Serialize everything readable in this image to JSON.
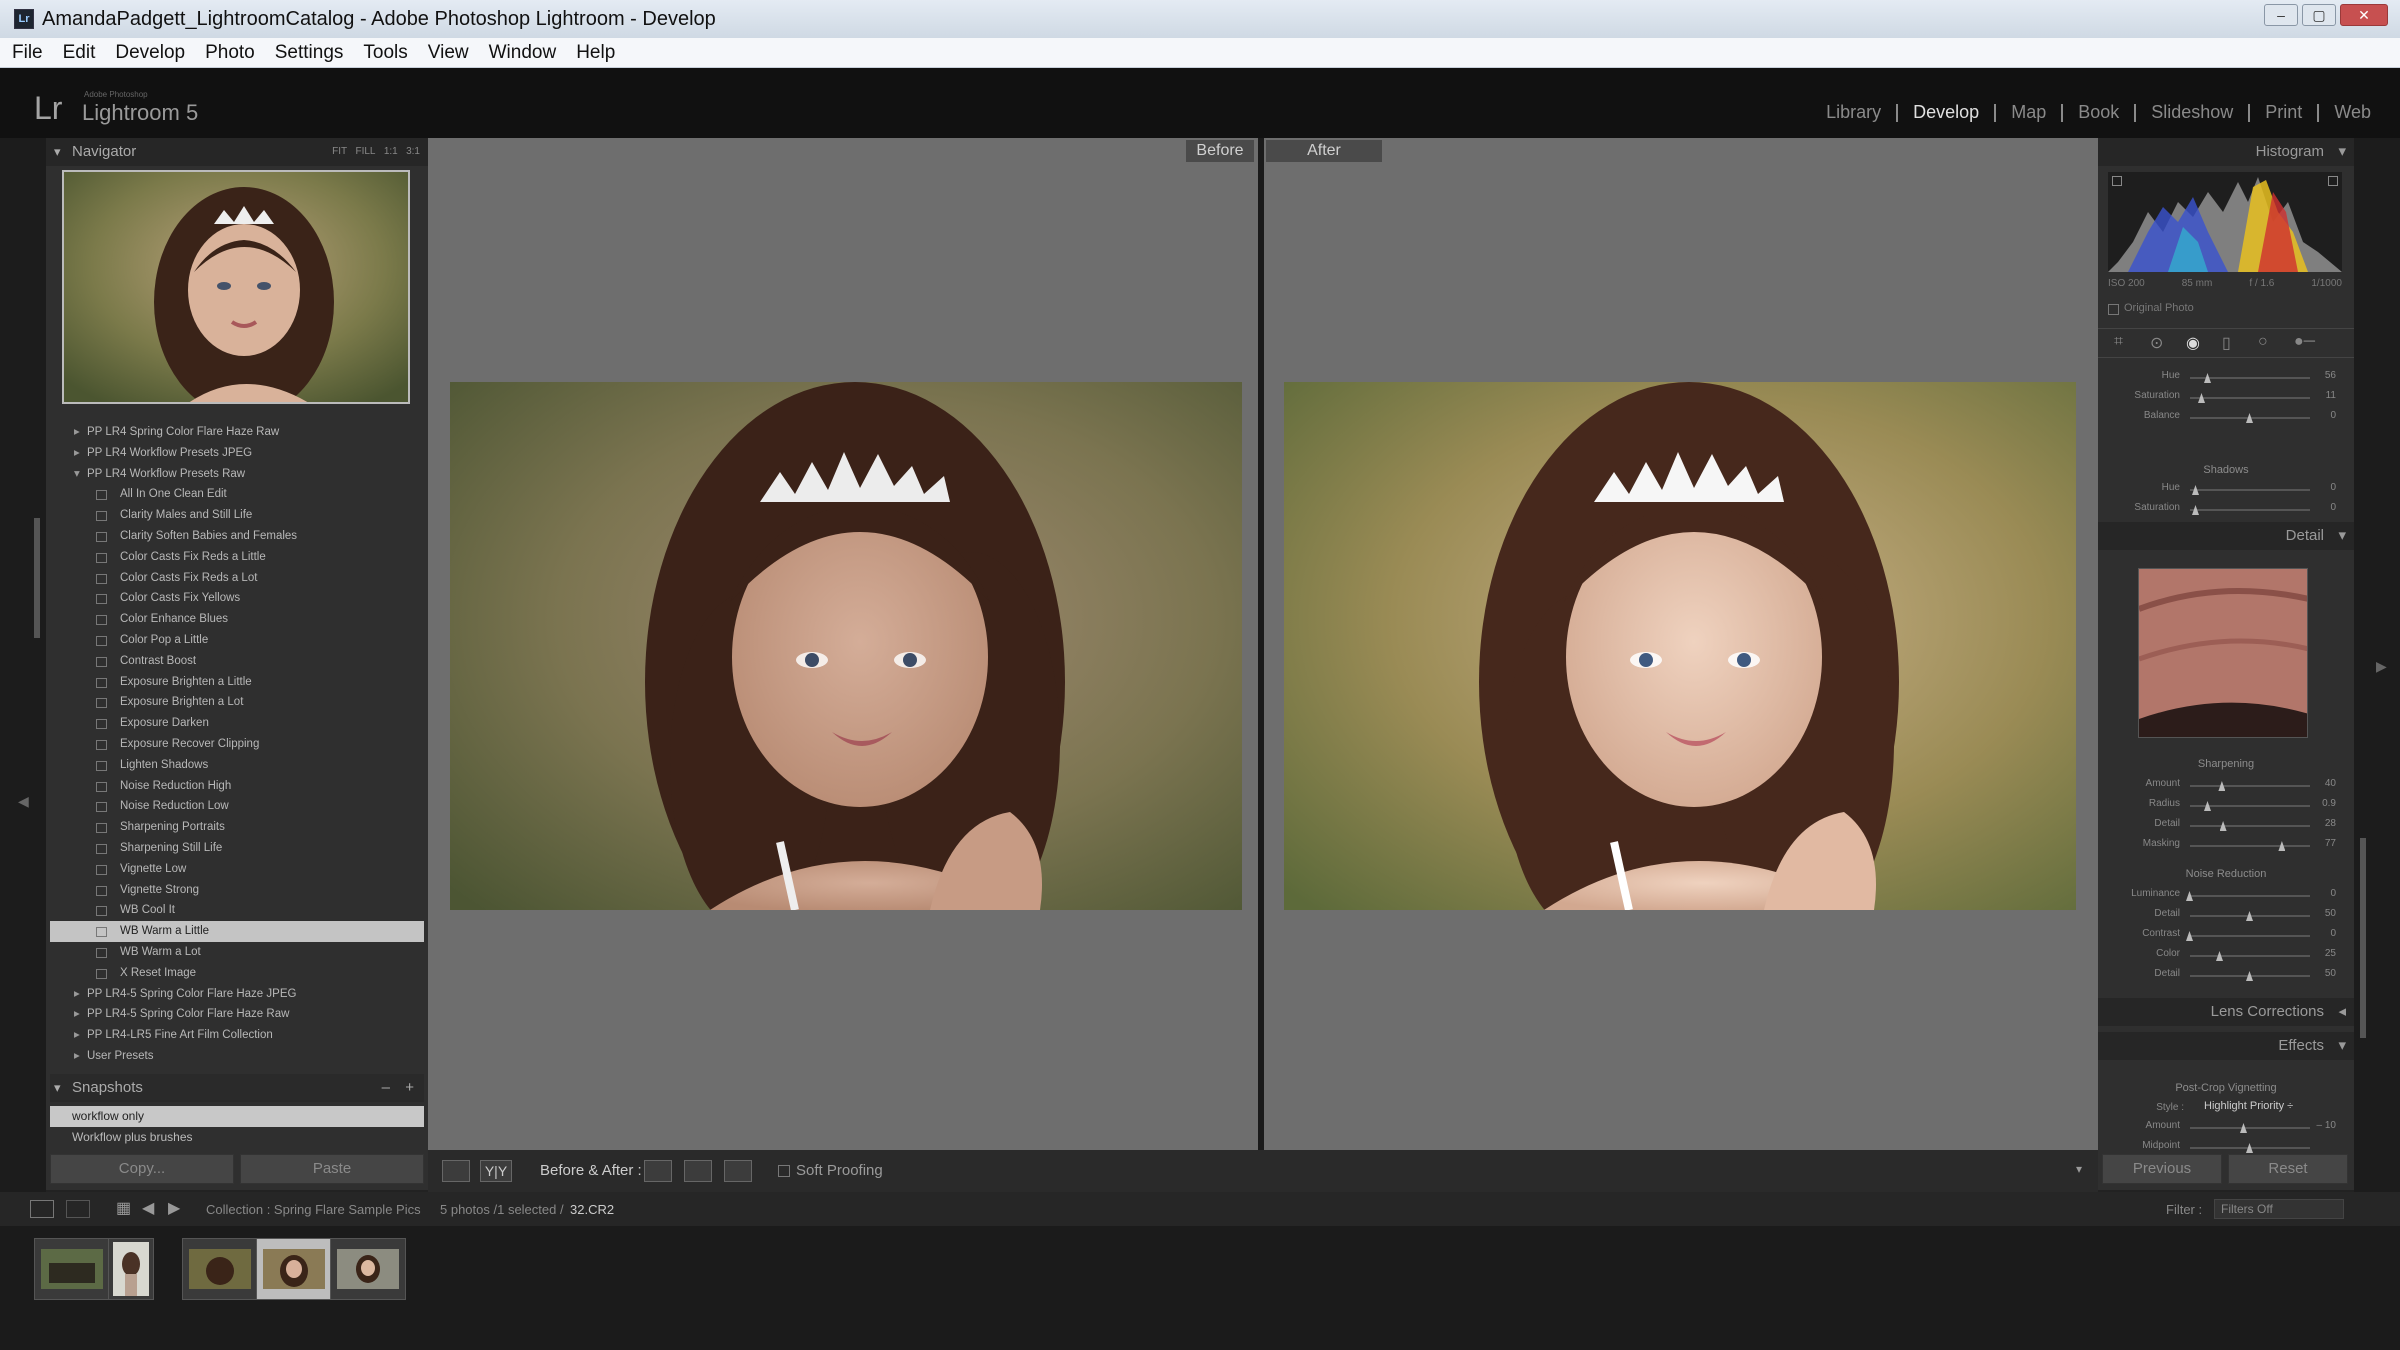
{
  "window": {
    "title": "AmandaPadgett_LightroomCatalog - Adobe Photoshop Lightroom - Develop",
    "min": "–",
    "max": "▢",
    "close": "✕"
  },
  "menu": [
    "File",
    "Edit",
    "Develop",
    "Photo",
    "Settings",
    "Tools",
    "View",
    "Window",
    "Help"
  ],
  "brand": {
    "lr": "Lr",
    "small": "Adobe Photoshop",
    "name": "Lightroom 5"
  },
  "modules": [
    "Library",
    "Develop",
    "Map",
    "Book",
    "Slideshow",
    "Print",
    "Web"
  ],
  "active_module": "Develop",
  "navigator": {
    "title": "Navigator",
    "zoom": [
      "FIT",
      "FILL",
      "1:1",
      "3:1"
    ]
  },
  "presets": [
    {
      "label": "PP LR4 Spring Color Flare Haze Raw",
      "type": "folder"
    },
    {
      "label": "PP LR4 Workflow Presets JPEG",
      "type": "folder"
    },
    {
      "label": "PP LR4 Workflow Presets Raw",
      "type": "folder-open"
    },
    {
      "label": "All In One Clean Edit",
      "type": "sub"
    },
    {
      "label": "Clarity Males and Still Life",
      "type": "sub"
    },
    {
      "label": "Clarity Soften Babies and Females",
      "type": "sub"
    },
    {
      "label": "Color Casts Fix Reds a Little",
      "type": "sub"
    },
    {
      "label": "Color Casts Fix Reds a Lot",
      "type": "sub"
    },
    {
      "label": "Color Casts Fix Yellows",
      "type": "sub"
    },
    {
      "label": "Color Enhance Blues",
      "type": "sub"
    },
    {
      "label": "Color Pop a Little",
      "type": "sub"
    },
    {
      "label": "Contrast Boost",
      "type": "sub"
    },
    {
      "label": "Exposure Brighten a Little",
      "type": "sub"
    },
    {
      "label": "Exposure Brighten a Lot",
      "type": "sub"
    },
    {
      "label": "Exposure Darken",
      "type": "sub"
    },
    {
      "label": "Exposure Recover Clipping",
      "type": "sub"
    },
    {
      "label": "Lighten Shadows",
      "type": "sub"
    },
    {
      "label": "Noise Reduction High",
      "type": "sub"
    },
    {
      "label": "Noise Reduction Low",
      "type": "sub"
    },
    {
      "label": "Sharpening Portraits",
      "type": "sub"
    },
    {
      "label": "Sharpening Still Life",
      "type": "sub"
    },
    {
      "label": "Vignette Low",
      "type": "sub"
    },
    {
      "label": "Vignette Strong",
      "type": "sub"
    },
    {
      "label": "WB Cool It",
      "type": "sub"
    },
    {
      "label": "WB Warm a Little",
      "type": "sub",
      "selected": true
    },
    {
      "label": "WB Warm a Lot",
      "type": "sub"
    },
    {
      "label": "X Reset Image",
      "type": "sub"
    },
    {
      "label": "PP LR4-5 Spring Color Flare Haze JPEG",
      "type": "folder"
    },
    {
      "label": "PP LR4-5 Spring Color Flare Haze Raw",
      "type": "folder"
    },
    {
      "label": "PP LR4-LR5 Fine Art Film Collection",
      "type": "folder"
    },
    {
      "label": "User Presets",
      "type": "folder"
    }
  ],
  "snapshots": {
    "title": "Snapshots",
    "minus": "–",
    "plus": "+",
    "items": [
      "workflow only",
      "Workflow plus brushes"
    ]
  },
  "left_buttons": {
    "copy": "Copy...",
    "paste": "Paste"
  },
  "center": {
    "before": "Before",
    "after": "After"
  },
  "toolbar": {
    "ba_label": "Before & After :",
    "soft_proofing": "Soft Proofing",
    "yy": "Y|Y"
  },
  "right": {
    "histogram": "Histogram",
    "hist_info": [
      "ISO 200",
      "85 mm",
      "f / 1.6",
      "1/1000"
    ],
    "original_photo": "Original Photo",
    "top_sliders": [
      {
        "label": "Hue",
        "value": "56",
        "pos": 0.15
      },
      {
        "label": "Saturation",
        "value": "11",
        "pos": 0.1
      },
      {
        "label": "Balance",
        "value": "0",
        "pos": 0.5
      }
    ],
    "shadows": "Shadows",
    "shadow_sliders": [
      {
        "label": "Hue",
        "value": "0",
        "pos": 0.05
      },
      {
        "label": "Saturation",
        "value": "0",
        "pos": 0.05
      }
    ],
    "detail": "Detail",
    "sharpening": "Sharpening",
    "sharp_sliders": [
      {
        "label": "Amount",
        "value": "40",
        "pos": 0.27
      },
      {
        "label": "Radius",
        "value": "0.9",
        "pos": 0.15
      },
      {
        "label": "Detail",
        "value": "28",
        "pos": 0.28
      },
      {
        "label": "Masking",
        "value": "77",
        "pos": 0.77
      }
    ],
    "noise_reduction": "Noise Reduction",
    "nr_sliders": [
      {
        "label": "Luminance",
        "value": "0",
        "pos": 0.0
      },
      {
        "label": "Detail",
        "value": "50",
        "pos": 0.5
      },
      {
        "label": "Contrast",
        "value": "0",
        "pos": 0.0
      },
      {
        "label": "Color",
        "value": "25",
        "pos": 0.25
      },
      {
        "label": "Detail",
        "value": "50",
        "pos": 0.5
      }
    ],
    "lens_corrections": "Lens Corrections",
    "effects": "Effects",
    "post_crop": "Post-Crop Vignetting",
    "style_label": "Style :",
    "style_value": "Highlight Priority ÷",
    "effect_sliders": [
      {
        "label": "Amount",
        "value": "– 10",
        "pos": 0.45
      },
      {
        "label": "Midpoint",
        "value": "",
        "pos": 0.5
      }
    ],
    "previous": "Previous",
    "reset": "Reset"
  },
  "filmstrip": {
    "collection": "Collection : Spring Flare Sample Pics",
    "count": "5 photos /1 selected /",
    "file": "32.CR2",
    "filter_label": "Filter :",
    "filter_value": "Filters Off"
  }
}
